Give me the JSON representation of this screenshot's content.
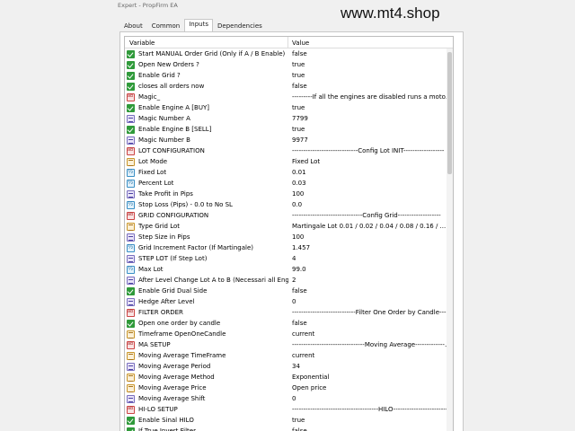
{
  "window": {
    "title": "Expert - PropFirm EA"
  },
  "watermark": "www.mt4.shop",
  "tabs": [
    {
      "label": "About",
      "active": false
    },
    {
      "label": "Common",
      "active": false
    },
    {
      "label": "Inputs",
      "active": true
    },
    {
      "label": "Dependencies",
      "active": false
    }
  ],
  "table": {
    "columns": {
      "variable": "Variable",
      "value": "Value"
    },
    "rows": [
      {
        "icon": "bool",
        "variable": "Start MANUAL Order  Grid   (Only if A / B Enable)",
        "value": "false"
      },
      {
        "icon": "bool",
        "variable": "Open New Orders ?",
        "value": "true"
      },
      {
        "icon": "bool",
        "variable": "Enable Grid ?",
        "value": "true"
      },
      {
        "icon": "bool",
        "variable": "closes all orders now",
        "value": "false"
      },
      {
        "icon": "str",
        "variable": "Magic_",
        "value": "---------If all the engines are disabled runs a motor i..."
      },
      {
        "icon": "bool",
        "variable": "Enable Engine A    [BUY]",
        "value": "true"
      },
      {
        "icon": "int",
        "variable": "Magic Number  A",
        "value": "7799"
      },
      {
        "icon": "bool",
        "variable": "Enable Engine B    [SELL]",
        "value": "true"
      },
      {
        "icon": "int",
        "variable": "Magic Number  B",
        "value": "9977"
      },
      {
        "icon": "str",
        "variable": "LOT CONFIGURATION",
        "value": "-----------------------------Config Lot INIT------------------"
      },
      {
        "icon": "enum",
        "variable": "Lot Mode",
        "value": "Fixed Lot"
      },
      {
        "icon": "dbl",
        "variable": "Fixed Lot",
        "value": "0.01"
      },
      {
        "icon": "dbl",
        "variable": "Percent Lot",
        "value": "0.03"
      },
      {
        "icon": "int",
        "variable": "Take Profit in Pips",
        "value": "100"
      },
      {
        "icon": "dbl",
        "variable": "Stop Loss (Pips) - 0.0 to No SL",
        "value": "0.0"
      },
      {
        "icon": "str",
        "variable": "GRID CONFIGURATION",
        "value": "-------------------------------Config Grid-------------------"
      },
      {
        "icon": "enum",
        "variable": "Type Grid Lot",
        "value": "Martingale Lot  0.01 / 0.02 / 0.04 / 0.08 / 0.16 / ..."
      },
      {
        "icon": "int",
        "variable": "Step Size in Pips",
        "value": "100"
      },
      {
        "icon": "dbl",
        "variable": "Grid Increment Factor (If Martingale)",
        "value": "1.457"
      },
      {
        "icon": "int",
        "variable": "STEP LOT (If  Step Lot)",
        "value": "4"
      },
      {
        "icon": "dbl",
        "variable": "Max Lot",
        "value": "99.0"
      },
      {
        "icon": "int",
        "variable": "After Level Change Lot A to B (Necessari all Engi...",
        "value": "2"
      },
      {
        "icon": "bool",
        "variable": "Enable Grid Dual Side",
        "value": "false"
      },
      {
        "icon": "int",
        "variable": "Hedge After Level",
        "value": "0"
      },
      {
        "icon": "str",
        "variable": "FILTER ORDER",
        "value": "----------------------------Filter One Order by Candle----------"
      },
      {
        "icon": "bool",
        "variable": "Open one order by candle",
        "value": "false"
      },
      {
        "icon": "enum",
        "variable": "Timeframe OpenOneCandle",
        "value": "current"
      },
      {
        "icon": "str",
        "variable": "MA SETUP",
        "value": "--------------------------------Moving Average-------------------"
      },
      {
        "icon": "enum",
        "variable": "Moving Average TimeFrame",
        "value": "current"
      },
      {
        "icon": "int",
        "variable": "Moving Average Period",
        "value": "34"
      },
      {
        "icon": "enum",
        "variable": "Moving Average Method",
        "value": "Exponential"
      },
      {
        "icon": "enum",
        "variable": "Moving Average Price",
        "value": "Open price"
      },
      {
        "icon": "int",
        "variable": "Moving Average Shift",
        "value": "0"
      },
      {
        "icon": "str",
        "variable": "HI-LO SETUP",
        "value": "--------------------------------------HILO-------------------------"
      },
      {
        "icon": "bool",
        "variable": "Enable Sinal  HILO",
        "value": "true"
      },
      {
        "icon": "bool",
        "variable": "If True Invert Filter",
        "value": "false"
      }
    ]
  }
}
